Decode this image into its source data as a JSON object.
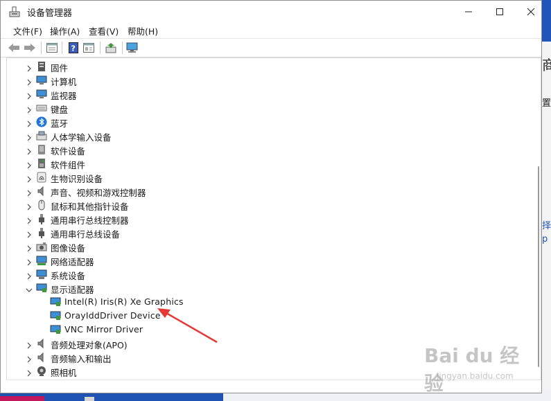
{
  "window": {
    "title": "设备管理器"
  },
  "menu": [
    "文件(F)",
    "操作(A)",
    "查看(V)",
    "帮助(H)"
  ],
  "toolbar": [
    "back-arrow",
    "forward-arrow",
    "properties-view",
    "help",
    "update-driver",
    "scan-hardware",
    "computer-monitor"
  ],
  "tree": [
    {
      "label": "固件",
      "icon": "firmware-icon",
      "expanded": false
    },
    {
      "label": "计算机",
      "icon": "computer-icon",
      "expanded": false
    },
    {
      "label": "监视器",
      "icon": "monitor-icon",
      "expanded": false
    },
    {
      "label": "键盘",
      "icon": "keyboard-icon",
      "expanded": false
    },
    {
      "label": "蓝牙",
      "icon": "bluetooth-icon",
      "expanded": false
    },
    {
      "label": "人体学输入设备",
      "icon": "hid-icon",
      "expanded": false
    },
    {
      "label": "软件设备",
      "icon": "software-device-icon",
      "expanded": false
    },
    {
      "label": "软件组件",
      "icon": "software-component-icon",
      "expanded": false
    },
    {
      "label": "生物识别设备",
      "icon": "fingerprint-icon",
      "expanded": false
    },
    {
      "label": "声音、视频和游戏控制器",
      "icon": "speaker-icon",
      "expanded": false
    },
    {
      "label": "鼠标和其他指针设备",
      "icon": "mouse-icon",
      "expanded": false
    },
    {
      "label": "通用串行总线控制器",
      "icon": "usb-icon",
      "expanded": false
    },
    {
      "label": "通用串行总线设备",
      "icon": "usb-icon",
      "expanded": false
    },
    {
      "label": "图像设备",
      "icon": "camera-icon",
      "expanded": false
    },
    {
      "label": "网络适配器",
      "icon": "network-icon",
      "expanded": false
    },
    {
      "label": "系统设备",
      "icon": "system-icon",
      "expanded": false
    },
    {
      "label": "显示适配器",
      "icon": "display-adapter-icon",
      "expanded": true,
      "children": [
        "Intel(R) Iris(R) Xe Graphics",
        "OrayIddDriver Device",
        "VNC Mirror Driver"
      ]
    },
    {
      "label": "音频处理对象(APO)",
      "icon": "speaker-icon",
      "expanded": false
    },
    {
      "label": "音频输入和输出",
      "icon": "speaker-icon",
      "expanded": false
    },
    {
      "label": "照相机",
      "icon": "webcam-icon",
      "expanded": false
    }
  ],
  "colors": {
    "accent": "#1f56b8",
    "annotation_arrow": "#e53935"
  },
  "background": {
    "right_fragments": [
      "商",
      "置",
      "择",
      "p"
    ]
  },
  "watermark": {
    "main": "Bai du 经验",
    "sub": "jingyan.baidu.com"
  }
}
